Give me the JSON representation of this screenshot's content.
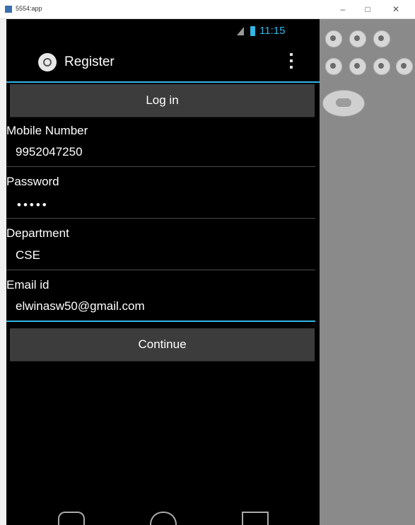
{
  "window": {
    "title": "5554:app"
  },
  "status_bar": {
    "time": "11:15"
  },
  "action_bar": {
    "title": "Register"
  },
  "form": {
    "login_button": "Log in",
    "mobile_label": "Mobile Number",
    "mobile_value": "9952047250",
    "password_label": "Password",
    "password_value": "•••••",
    "department_label": "Department",
    "department_value": "CSE",
    "email_label": "Email id",
    "email_value": "elwinasw50@gmail.com",
    "continue_button": "Continue"
  },
  "colors": {
    "accent": "#33b5e5",
    "background": "#000000",
    "button": "#3c3c3c"
  }
}
